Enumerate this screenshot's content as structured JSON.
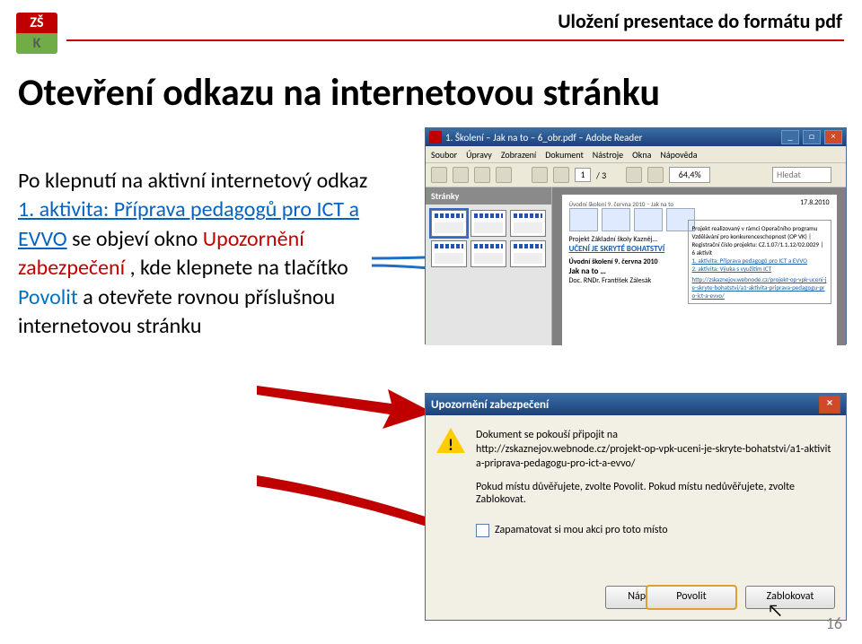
{
  "header": {
    "logo_top": "ZŠ",
    "logo_bottom": "K",
    "title": "Uložení presentace do formátu pdf"
  },
  "main_title": "Otevření odkazu na internetovou stránku",
  "body": {
    "p1a": "Po klepnutí na aktivní internetový odkaz ",
    "link": "1. aktivita: Příprava pedagogů pro ICT a EVVO",
    "p1b": " se objeví okno ",
    "red": "Upozornění zabezpečení",
    "p1c": " , kde klepnete na tlačítko ",
    "blue": "Povolit",
    "p1d": " a otevřete rovnou příslušnou internetovou stránku"
  },
  "pdf": {
    "title": "1. Školení – Jak na to – 6_obr.pdf – Adobe Reader",
    "menu": {
      "soubor": "Soubor",
      "upravy": "Úpravy",
      "zobrazeni": "Zobrazení",
      "dokument": "Dokument",
      "nastroje": "Nástroje",
      "okna": "Okna",
      "napoveda": "Nápověda"
    },
    "page_cur": "1",
    "page_total": "/ 3",
    "find": "Hledat",
    "zoom": "64,4%",
    "side_title": "Stránky",
    "doc": {
      "header_right": "17.8.2010",
      "top_line": "Úvodní školení 9. června 2010 – Jak na to",
      "line1": "Projekt Základní školy Kazněj…",
      "line2": "UČENÍ JE SKRYTÉ BOHATSTVÍ",
      "sub1": "Úvodní školení 9. června 2010",
      "sub2": "Jak na to …",
      "author": "Doc. RNDr. František Zálesák",
      "right_col_top": "Projekt realizovaný v rámci Operačního programu Vzdělávání pro konkurenceschopnost (OP VK) | Registrační číslo projektu: CZ.1.07/1.1.12/02.0029 | 6 aktivit",
      "link1": "1. aktivita: Příprava pedagogů pro ICT a EVVO",
      "link2": "2. aktivita: Výuka s využitím ICT",
      "url": "http://zskaznejov.webnode.cz/projekt-op-vpk-uceni-je-skryte-bohatstvi/a1-aktivita-priprava-pedagogu-pro-ict-a-evvo/"
    }
  },
  "dialog": {
    "title": "Upozornění zabezpečení",
    "line1": "Dokument se pokouší připojit na",
    "url": "http://zskaznejov.webnode.cz/projekt-op-vpk-uceni-je-skryte-bohatstvi/a1-aktivita-priprava-pedagogu-pro-ict-a-evvo/",
    "trust": "Pokud místu důvěřujete, zvolte Povolit. Pokud místu nedůvěřujete, zvolte Zablokovat.",
    "remember": "Zapamatovat si mou akci pro toto místo",
    "napoveda": "Nápověda",
    "povolit": "Povolit",
    "zablokovat": "Zablokovat"
  },
  "page_number": "16"
}
